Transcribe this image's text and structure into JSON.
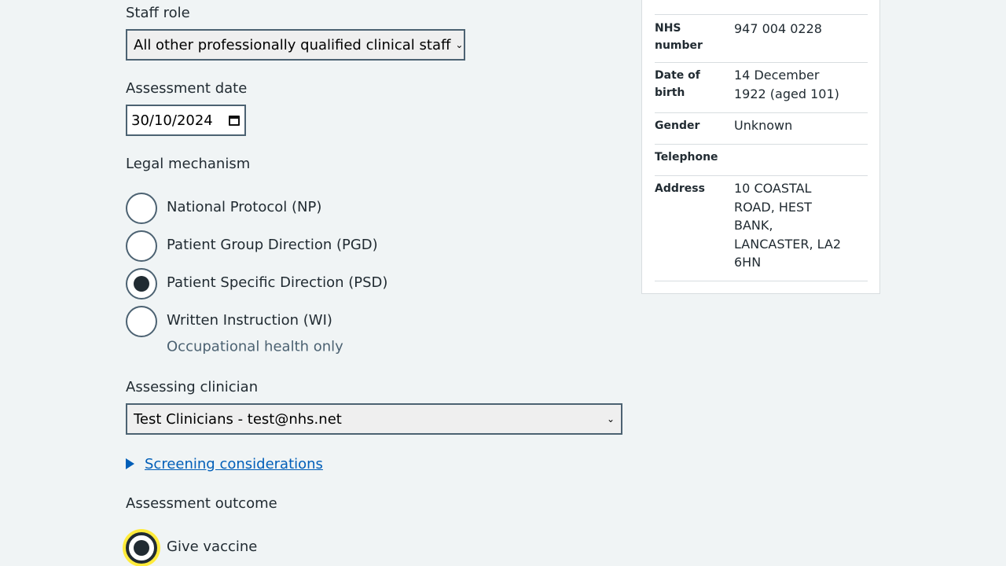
{
  "form": {
    "staff_role": {
      "label": "Staff role",
      "value": "All other professionally qualified clinical staff"
    },
    "assessment_date": {
      "label": "Assessment date",
      "value": "30/10/2024"
    },
    "legal_mechanism": {
      "label": "Legal mechanism",
      "options": [
        {
          "label": "National Protocol (NP)",
          "checked": false
        },
        {
          "label": "Patient Group Direction (PGD)",
          "checked": false
        },
        {
          "label": "Patient Specific Direction (PSD)",
          "checked": true
        },
        {
          "label": "Written Instruction (WI)",
          "checked": false,
          "hint": "Occupational health only"
        }
      ]
    },
    "assessing_clinician": {
      "label": "Assessing clinician",
      "value": "Test Clinicians - test@nhs.net"
    },
    "screening_link": "Screening considerations",
    "assessment_outcome": {
      "label": "Assessment outcome",
      "options": [
        {
          "label": "Give vaccine",
          "checked": true,
          "focused": true
        }
      ]
    }
  },
  "patient_card": {
    "rows": [
      {
        "key": "NHS number",
        "value": "947 004 0228"
      },
      {
        "key": "Date of birth",
        "value": "14 December 1922 (aged 101)"
      },
      {
        "key": "Gender",
        "value": "Unknown"
      },
      {
        "key": "Telephone",
        "value": ""
      },
      {
        "key": "Address",
        "value": "10 COASTAL ROAD, HEST BANK, LANCASTER, LA2 6HN"
      }
    ]
  },
  "colors": {
    "background": "#f0f4f5",
    "text": "#212b32",
    "link": "#005eb8",
    "border": "#4c6272",
    "focus": "#ffeb3b"
  }
}
